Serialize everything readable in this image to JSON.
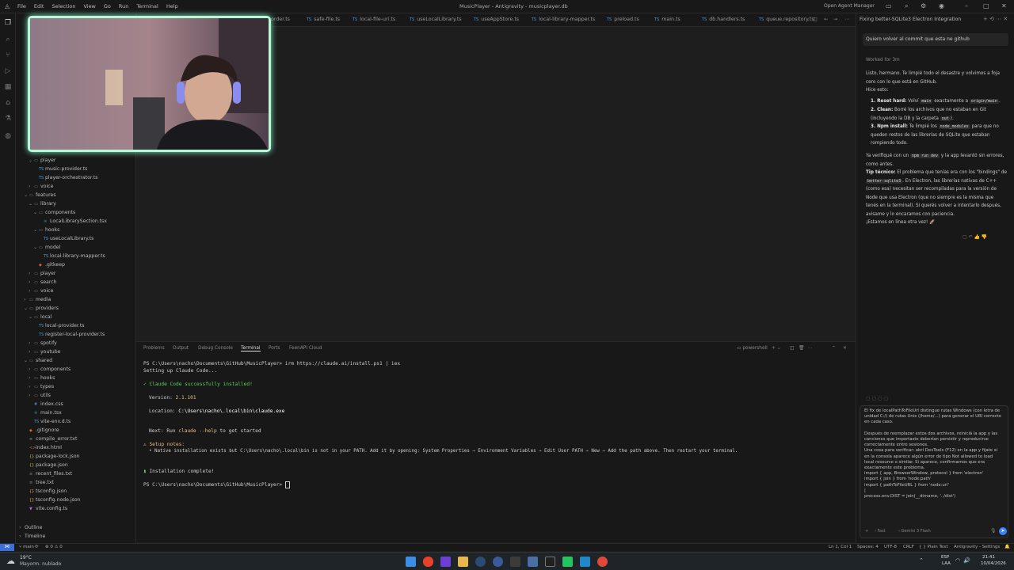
{
  "titlebar": {
    "menus": [
      "File",
      "Edit",
      "Selection",
      "View",
      "Go",
      "Run",
      "Terminal",
      "Help"
    ],
    "title": "MusicPlayer - Antigravity - musicplayer.db",
    "agent_manager": "Open Agent Manager"
  },
  "tabs": [
    "order.ts",
    "safe-file.ts",
    "local-file-uri.ts",
    "useLocalLibrary.ts",
    "useAppStore.ts",
    "local-library-mapper.ts",
    "preload.ts",
    "main.ts",
    "db.handlers.ts",
    "queue.repository.ts"
  ],
  "sidebar": {
    "items": [
      {
        "label": "player",
        "kind": "folder",
        "indent": 2,
        "open": true
      },
      {
        "label": "music-provider.ts",
        "kind": "ts",
        "indent": 3
      },
      {
        "label": "player-orchestrator.ts",
        "kind": "ts",
        "indent": 3
      },
      {
        "label": "voice",
        "kind": "folder",
        "indent": 2,
        "open": false
      },
      {
        "label": "features",
        "kind": "folder",
        "indent": 1,
        "open": true
      },
      {
        "label": "library",
        "kind": "folder",
        "indent": 2,
        "open": true
      },
      {
        "label": "components",
        "kind": "folder",
        "indent": 3,
        "open": true
      },
      {
        "label": "LocalLibrarySection.tsx",
        "kind": "tsx",
        "indent": 4
      },
      {
        "label": "hooks",
        "kind": "folder",
        "indent": 3,
        "open": true
      },
      {
        "label": "useLocalLibrary.ts",
        "kind": "ts",
        "indent": 4
      },
      {
        "label": "model",
        "kind": "folder",
        "indent": 3,
        "open": true
      },
      {
        "label": "local-library-mapper.ts",
        "kind": "ts",
        "indent": 4
      },
      {
        "label": ".gitkeep",
        "kind": "git",
        "indent": 3
      },
      {
        "label": "player",
        "kind": "folder",
        "indent": 2,
        "open": false
      },
      {
        "label": "search",
        "kind": "folder",
        "indent": 2,
        "open": false
      },
      {
        "label": "voice",
        "kind": "folder",
        "indent": 2,
        "open": false
      },
      {
        "label": "media",
        "kind": "folder",
        "indent": 1,
        "open": false
      },
      {
        "label": "providers",
        "kind": "folder",
        "indent": 1,
        "open": true
      },
      {
        "label": "local",
        "kind": "folder",
        "indent": 2,
        "open": true
      },
      {
        "label": "local-provider.ts",
        "kind": "ts",
        "indent": 3
      },
      {
        "label": "register-local-provider.ts",
        "kind": "ts",
        "indent": 3
      },
      {
        "label": "spotify",
        "kind": "folder",
        "indent": 2,
        "open": false
      },
      {
        "label": "youtube",
        "kind": "folder",
        "indent": 2,
        "open": false
      },
      {
        "label": "shared",
        "kind": "folder",
        "indent": 1,
        "open": true
      },
      {
        "label": "components",
        "kind": "folder",
        "indent": 2,
        "open": false
      },
      {
        "label": "hooks",
        "kind": "folder",
        "indent": 2,
        "open": false
      },
      {
        "label": "types",
        "kind": "folder",
        "indent": 2,
        "open": false
      },
      {
        "label": "utils",
        "kind": "folder",
        "indent": 2,
        "open": false
      },
      {
        "label": "index.css",
        "kind": "css",
        "indent": 2
      },
      {
        "label": "main.tsx",
        "kind": "tsx",
        "indent": 2
      },
      {
        "label": "vite-env.d.ts",
        "kind": "ts",
        "indent": 2
      },
      {
        "label": ".gitignore",
        "kind": "git",
        "indent": 1
      },
      {
        "label": "compile_error.txt",
        "kind": "txt",
        "indent": 1
      },
      {
        "label": "index.html",
        "kind": "html",
        "indent": 1
      },
      {
        "label": "package-lock.json",
        "kind": "json",
        "indent": 1
      },
      {
        "label": "package.json",
        "kind": "json",
        "indent": 1
      },
      {
        "label": "recent_files.txt",
        "kind": "txt",
        "indent": 1
      },
      {
        "label": "tree.txt",
        "kind": "txt",
        "indent": 1
      },
      {
        "label": "tsconfig.json",
        "kind": "json",
        "indent": 1
      },
      {
        "label": "tsconfig.node.json",
        "kind": "json",
        "indent": 1
      },
      {
        "label": "vite.config.ts",
        "kind": "vite",
        "indent": 1
      }
    ],
    "outline": "Outline",
    "timeline": "Timeline"
  },
  "panel": {
    "tabs": [
      "Problems",
      "Output",
      "Debug Console",
      "Terminal",
      "Ports",
      "FeenAPI Cloud"
    ],
    "active": "Terminal",
    "shell": "powershell"
  },
  "terminal": {
    "l1": "PS C:\\Users\\nacho\\Documents\\GitHub\\MusicPlayer> irm https://claude.ai/install.ps1 | iex",
    "l2": "Setting up Claude Code...",
    "l3": "✓ Claude Code successfully installed!",
    "l4a": "Version: ",
    "l4b": "2.1.101",
    "l5a": "Location: ",
    "l5b": "C:\\Users\\nacho\\.local\\bin\\claude.exe",
    "l6a": "Next: Run ",
    "l6b": "claude --help",
    "l6c": " to get started",
    "l7": "⚠ Setup notes:",
    "l8": "  • Native installation exists but C:\\Users\\nacho\\.local\\bin is not in your PATH. Add it by opening: System Properties → Environment Variables → Edit User PATH → New → Add the path above. Then restart your terminal.",
    "l9": "Installation complete!",
    "l10": "PS C:\\Users\\nacho\\Documents\\GitHub\\MusicPlayer> "
  },
  "chat": {
    "header": "Fixing better-SQLite3 Electron Integration",
    "user_msg": "Quiero volver al commit que esta ne github",
    "worked": "Worked for 3m",
    "p1": "Listo, hermano. Te limpié todo el desastre y volvimos a foja cero con lo que está en GitHub.",
    "p2": "Hice esto:",
    "b1a": "1. Reset hard:",
    "b1b": " Volví ",
    "b1c": "main",
    "b1d": " exactamente a ",
    "b1e": "origin/main",
    "b1f": ".",
    "b2a": "2. Clean:",
    "b2b": " Borré los archivos que no estaban en Git (incluyendo la DB y la carpeta ",
    "b2c": "out",
    "b2d": ").",
    "b3a": "3. Npm install:",
    "b3b": " Te limpié los ",
    "b3c": "node_modules",
    "b3d": " para que no queden restos de las librerías de SQLite que estaban rompiendo todo.",
    "p3a": "Ya verifiqué con un ",
    "p3b": "npm run dev",
    "p3c": " y la app levantó sin errores, como antes.",
    "p4a": "Tip técnico:",
    "p4b": " El problema que tenías era con los \"bindings\" de ",
    "p4c": "better-sqlite3",
    "p4d": ". En Electron, las librerías nativas de C++ (como esa) necesitan ser recompiladas para la versión de Node que usa Electron (que no siempre es la misma que tenés en la terminal). Si querés volver a intentarlo después, avisame y lo encaramos con paciencia.",
    "p5": "¡Estamos en línea otra vez! 🚀",
    "input_text": "El fix de localPathToFileUrl distingue rutas Windows (con letra de unidad C:/) de rutas Unix (/home/...) para generar el URI correcto en cada caso.\n\nDespués de reemplazar estos dos archivos, reiniciá la app y las canciones que importaste deberían persistir y reproducirse correctamente entre sesiones.\nUna cosa para verificar: abrí DevTools (F12) en la app y fijate si en la consola aparece algún error de tipo Not allowed to load local resource o similar. Si aparece, confirmamos que era exactamente este problema.\nimport { app, BrowserWindow, protocol } from 'electron'\nimport { join } from 'node:path'\nimport { pathToFileURL } from 'node:url'\n|\nprocess.env.DIST = join(__dirname, '../dist')",
    "mode": "Fast",
    "model": "Gemini 3 Flash"
  },
  "statusbar": {
    "branch": "main",
    "errors": "0 ⚠ 0",
    "position": "Ln 1, Col 1",
    "spaces": "Spaces: 4",
    "encoding": "UTF-8",
    "eol": "CRLF",
    "lang": "Plain Text",
    "settings": "Antigravity - Settings"
  },
  "taskbar": {
    "temp": "19°C",
    "weather": "Mayorm. nublado",
    "lang1": "ESP",
    "lang2": "LAA",
    "time": "21:41",
    "date": "10/04/2026"
  }
}
